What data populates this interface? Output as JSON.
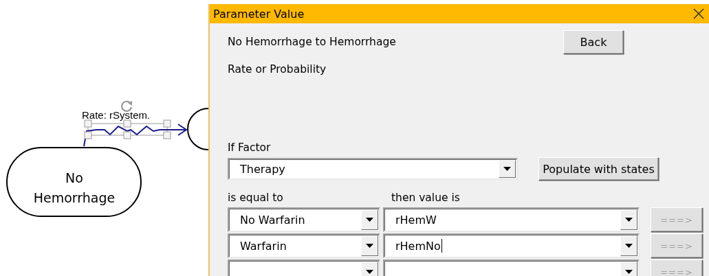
{
  "diagram": {
    "nodes": [
      {
        "kind": "rounded",
        "label": "No Hemorrhage"
      },
      {
        "kind": "circle"
      }
    ],
    "transition": {
      "label": "Rate: rSystem.",
      "selected": true
    }
  },
  "dialog": {
    "title": "Parameter Value",
    "transition": "No Hemorrhage to Hemorrhage",
    "value_type": "Rate or Probability",
    "back_button": "Back",
    "factor_label": "If Factor",
    "factor": "Therapy",
    "populate_button": "Populate with states",
    "columns": [
      "is equal to",
      "then value is"
    ],
    "rows": [
      {
        "state": "No Warfarin",
        "value": "rHemW",
        "focused": false,
        "action": "===>",
        "disabled": true
      },
      {
        "state": "Warfarin",
        "value": "rHemNo",
        "focused": true,
        "action": "===>",
        "disabled": true
      },
      {
        "action": "===>",
        "disabled": true
      }
    ]
  }
}
